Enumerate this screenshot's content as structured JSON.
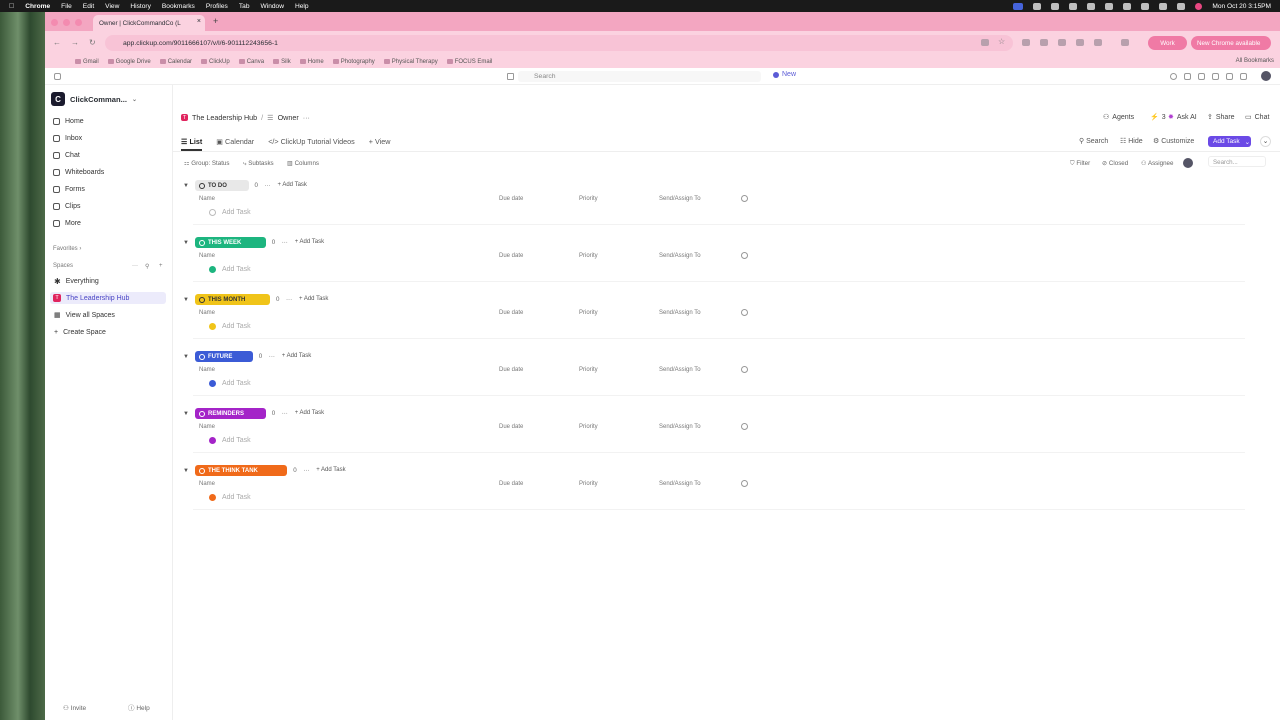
{
  "menubar": {
    "app": "Chrome",
    "items": [
      "File",
      "Edit",
      "View",
      "History",
      "Bookmarks",
      "Profiles",
      "Tab",
      "Window",
      "Help"
    ],
    "datetime": "Mon Oct 20  3:15PM"
  },
  "browser": {
    "tab_title": "Owner | ClickCommandCo (L",
    "url": "app.clickup.com/9011666107/v/l/6-901112243656-1",
    "profile_label": "Work",
    "update_label": "New Chrome available",
    "bookmarks": [
      "Gmail",
      "Google Drive",
      "Calendar",
      "ClickUp",
      "Canva",
      "Silk",
      "Home",
      "Photography",
      "Physical Therapy",
      "FOCUS Email"
    ],
    "all_bookmarks": "All Bookmarks"
  },
  "topbar": {
    "search_placeholder": "Search",
    "new_label": "New"
  },
  "sidebar": {
    "workspace": "ClickComman...",
    "workspace_initial": "C",
    "nav": [
      "Home",
      "Inbox",
      "Chat",
      "Whiteboards",
      "Forms",
      "Clips",
      "More"
    ],
    "favorites_label": "Favorites",
    "spaces_label": "Spaces",
    "spaces": [
      "Everything",
      "The Leadership Hub",
      "View all Spaces",
      "Create Space"
    ],
    "space_initial": "T",
    "invite": "Invite",
    "help": "Help"
  },
  "header": {
    "breadcrumb_space": "The Leadership Hub",
    "breadcrumb_list": "Owner",
    "agents": "Agents",
    "agents_count": "3",
    "ask_ai": "Ask AI",
    "share": "Share",
    "chat": "Chat"
  },
  "views": {
    "tabs": [
      "List",
      "Calendar",
      "ClickUp Tutorial Videos",
      "View"
    ],
    "search": "Search",
    "hide": "Hide",
    "customize": "Customize",
    "add_task": "Add Task"
  },
  "toolbar": {
    "group": "Group: Status",
    "subtasks": "Subtasks",
    "columns": "Columns",
    "filter": "Filter",
    "closed": "Closed",
    "assignee": "Assignee",
    "search_placeholder": "Search..."
  },
  "columns": {
    "name": "Name",
    "due": "Due date",
    "priority": "Priority",
    "assign": "Send/Assign To"
  },
  "groups": [
    {
      "label": "TO DO",
      "count": "0",
      "color": "#e8e8e8",
      "text": "#333",
      "dot": "#b0b0b0"
    },
    {
      "label": "THIS WEEK",
      "count": "0",
      "color": "#1db57f",
      "text": "#fff",
      "dot": "#1db57f"
    },
    {
      "label": "THIS MONTH",
      "count": "0",
      "color": "#f0c419",
      "text": "#333",
      "dot": "#f0c419"
    },
    {
      "label": "FUTURE",
      "count": "0",
      "color": "#3b5bd6",
      "text": "#fff",
      "dot": "#3b5bd6"
    },
    {
      "label": "REMINDERS",
      "count": "0",
      "color": "#a424c8",
      "text": "#fff",
      "dot": "#a424c8"
    },
    {
      "label": "THE THINK TANK",
      "count": "0",
      "color": "#f06a1a",
      "text": "#fff",
      "dot": "#f06a1a"
    }
  ],
  "add_task_label": "Add Task",
  "more_glyph": "···",
  "add_task_small": "+ Add Task"
}
